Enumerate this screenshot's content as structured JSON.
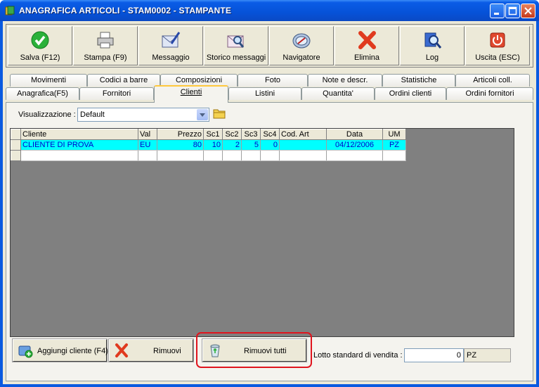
{
  "window": {
    "title": "ANAGRAFICA ARTICOLI - STAM0002 - STAMPANTE",
    "accent": "#0a5ae0"
  },
  "toolbar": {
    "buttons": [
      {
        "label": "Salva (F12)",
        "icon": "check-icon"
      },
      {
        "label": "Stampa (F9)",
        "icon": "printer-icon"
      },
      {
        "label": "Messaggio",
        "icon": "envelope-pen-icon"
      },
      {
        "label": "Storico messaggi",
        "icon": "envelope-search-icon"
      },
      {
        "label": "Navigatore",
        "icon": "compass-icon"
      },
      {
        "label": "Elimina",
        "icon": "red-x-icon"
      },
      {
        "label": "Log",
        "icon": "book-search-icon"
      },
      {
        "label": "Uscita (ESC)",
        "icon": "power-icon"
      }
    ]
  },
  "tabs": {
    "row1": [
      "Movimenti",
      "Codici a barre",
      "Composizioni",
      "Foto",
      "Note e descr.",
      "Statistiche",
      "Articoli coll."
    ],
    "row2": [
      "Anagrafica(F5)",
      "Fornitori",
      "Clienti",
      "Listini",
      "Quantita'",
      "Ordini clienti",
      "Ordini fornitori"
    ],
    "active": "Clienti"
  },
  "view": {
    "label": "Visualizzazione :",
    "selected": "Default"
  },
  "grid": {
    "columns": [
      "Cliente",
      "Val",
      "Prezzo",
      "Sc1",
      "Sc2",
      "Sc3",
      "Sc4",
      "Cod. Art",
      "Data",
      "UM"
    ],
    "rows": [
      [
        "CLIENTE DI PROVA",
        "EU",
        "80",
        "10",
        "2",
        "5",
        "0",
        "",
        "04/12/2006",
        "PZ"
      ]
    ]
  },
  "bottom": {
    "add_label": "Aggiungi cliente (F4)",
    "remove_label": "Rimuovi",
    "remove_all_label": "Rimuovi tutti",
    "lotto_label": "Lotto standard di vendita :",
    "lotto_value": "0",
    "lotto_um": "PZ"
  }
}
